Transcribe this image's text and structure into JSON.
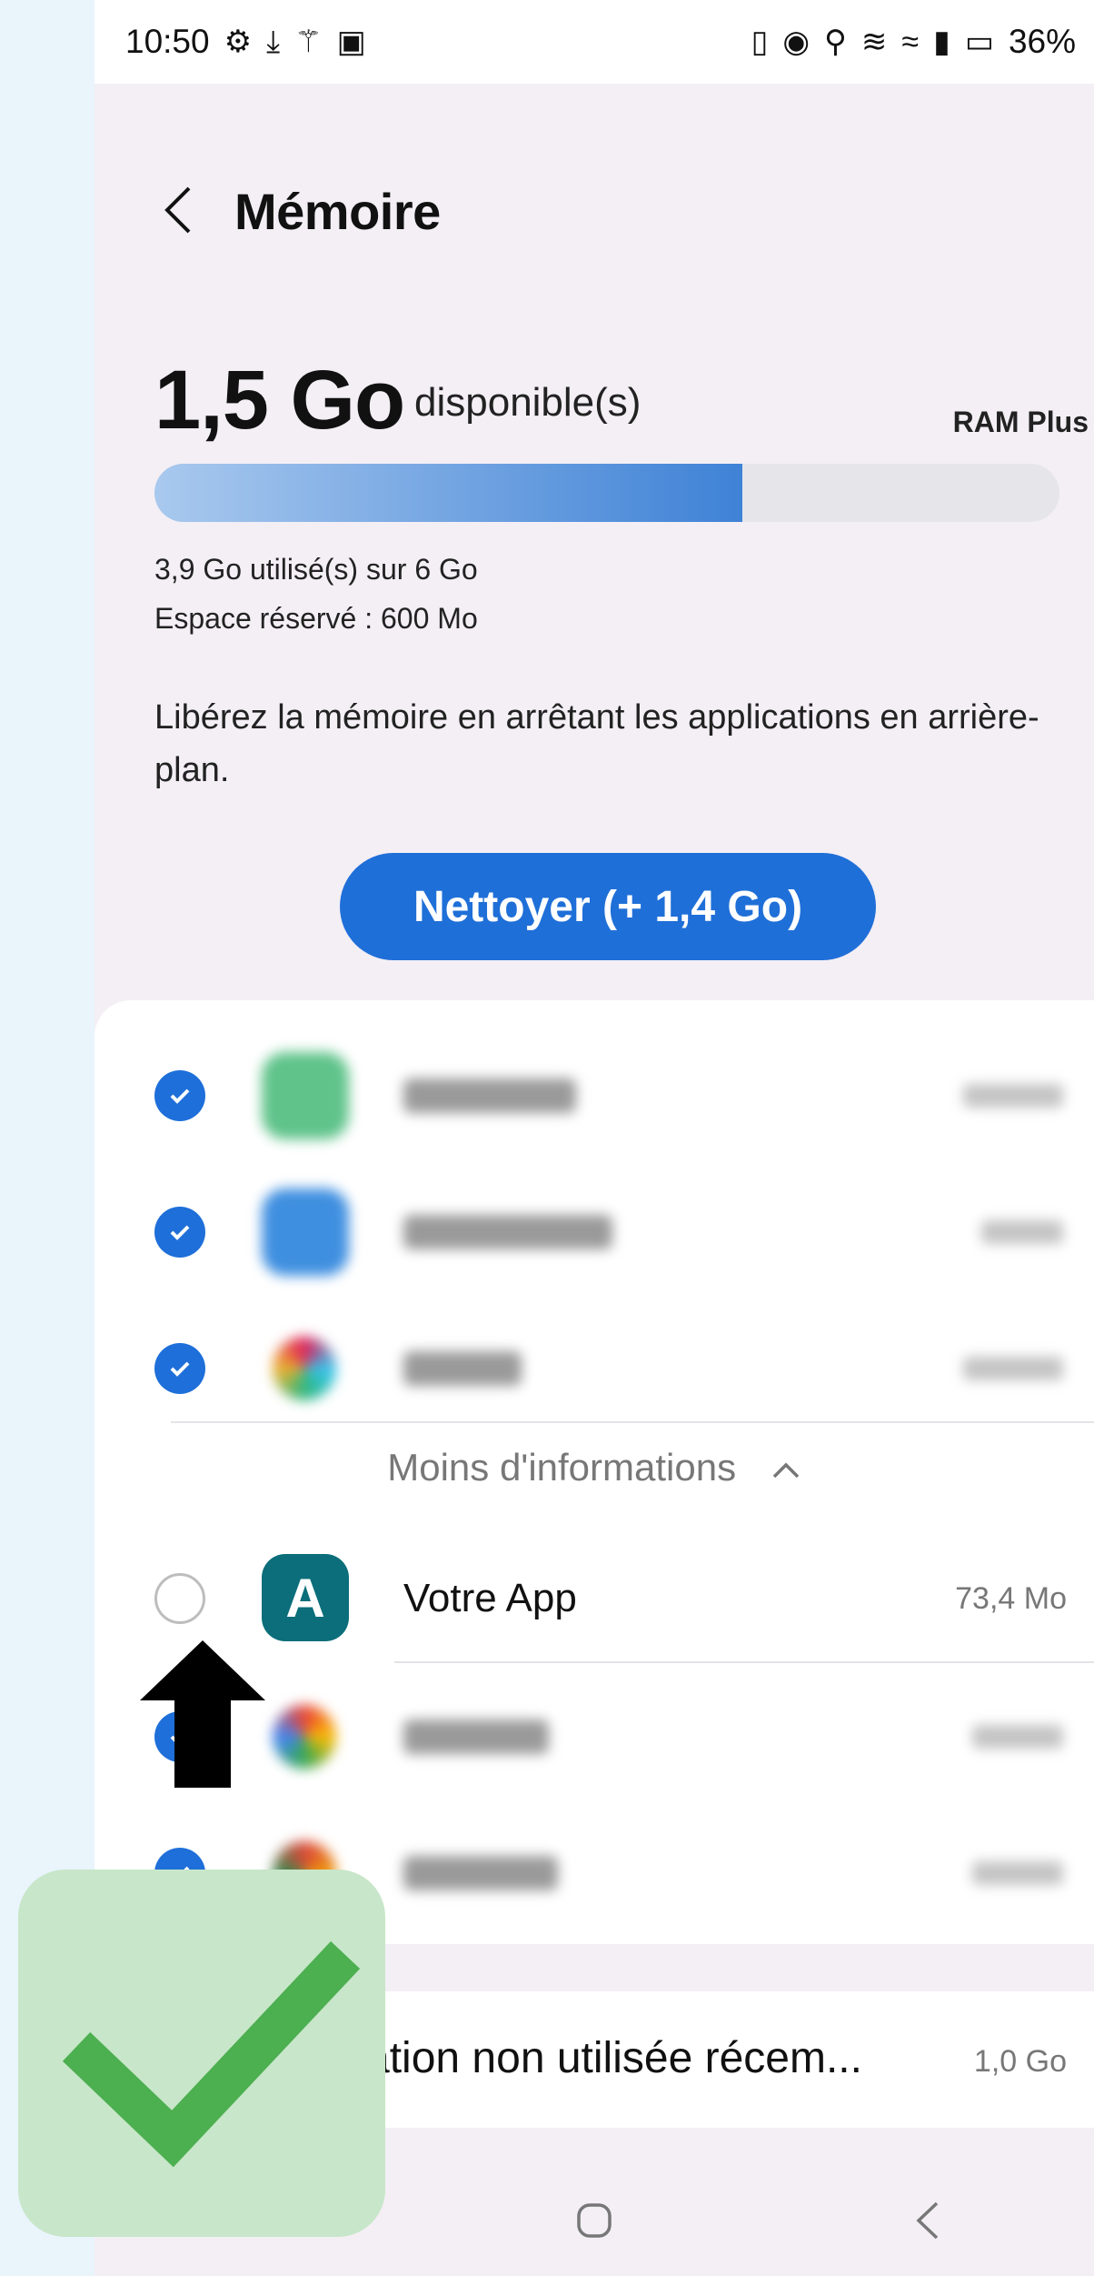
{
  "status_bar": {
    "time": "10:50",
    "battery": "36%",
    "left_icons": [
      "gear-icon",
      "download-icon",
      "magic-wand-icon",
      "image-icon"
    ],
    "right_icons": [
      "vibrate-icon",
      "sync-icon",
      "location-icon",
      "nfc-icon",
      "wifi-icon",
      "signal-icon",
      "battery-icon"
    ]
  },
  "header": {
    "title": "Mémoire"
  },
  "memory": {
    "available_value": "1,5 Go",
    "available_label": "disponible(s)",
    "ram_plus_label": "RAM Plus",
    "used_fraction": 0.65,
    "used_text": "3,9 Go utilisé(s) sur 6 Go",
    "reserved_text": "Espace réservé : 600 Mo"
  },
  "hint": "Libérez la mémoire en arrêtant les applications en arrière-plan.",
  "clean_button": {
    "label": "Nettoyer (+ 1,4 Go)"
  },
  "less_info": {
    "label": "Moins d'informations"
  },
  "highlighted_app": {
    "name": "Votre App",
    "size": "73,4 Mo",
    "icon_letter": "A"
  },
  "unused_apps": {
    "label": "cation non utilisée récem...",
    "size": "1,0 Go"
  },
  "colors": {
    "accent": "#1f6fd8",
    "check_green": "#4caf50",
    "panel_green": "#c8e6c9",
    "app_icon_teal": "#0b6e7a"
  }
}
